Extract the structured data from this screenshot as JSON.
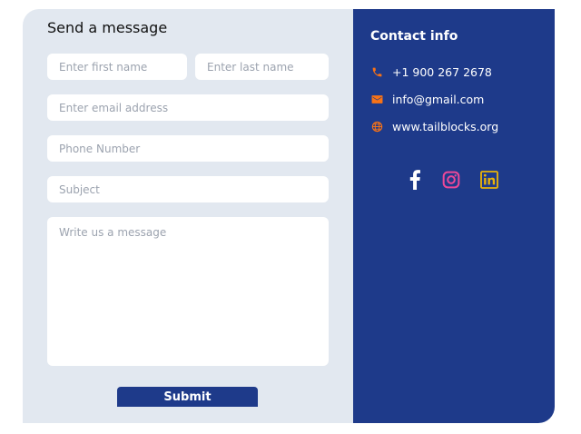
{
  "form": {
    "title": "Send a message",
    "first_name_placeholder": "Enter first name",
    "last_name_placeholder": "Enter last name",
    "email_placeholder": "Enter email address",
    "phone_placeholder": "Phone Number",
    "subject_placeholder": "Subject",
    "message_placeholder": "Write us a message",
    "submit_label": "Submit"
  },
  "contact": {
    "title": "Contact info",
    "phone": "+1 900 267 2678",
    "email": "info@gmail.com",
    "website": "www.tailblocks.org"
  },
  "icons": {
    "phone": "phone-icon",
    "email": "mail-icon",
    "website": "globe-icon",
    "facebook": "facebook-icon",
    "instagram": "instagram-icon",
    "linkedin": "linkedin-icon"
  },
  "colors": {
    "panel_bg": "#e2e8f0",
    "accent_blue": "#1e3a8a",
    "icon_orange": "#f97316",
    "instagram_pink": "#ec4899",
    "linkedin_yellow": "#eab308"
  }
}
